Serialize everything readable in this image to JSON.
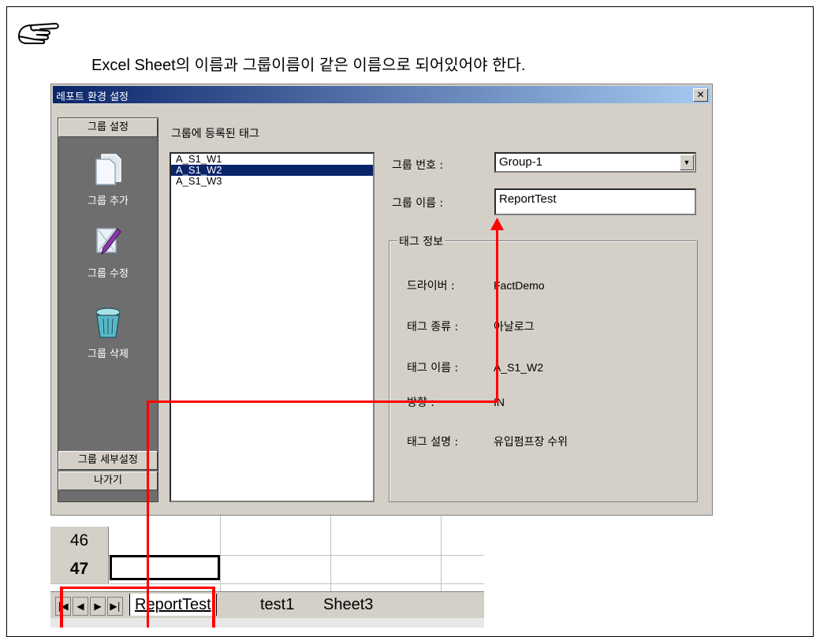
{
  "note": "Excel Sheet의 이름과 그룹이름이 같은 이름으로 되어있어야 한다.",
  "dialog": {
    "title": "레포트 환경 설정",
    "close_label": "✕",
    "sidebar": {
      "top_button": "그룹 설정",
      "items": [
        {
          "label": "그룹 추가",
          "icon": "pages-icon"
        },
        {
          "label": "그룹 수정",
          "icon": "edit-pencil-icon"
        },
        {
          "label": "그룹 삭제",
          "icon": "trash-can-icon"
        }
      ],
      "detail_button": "그룹 세부설정",
      "exit_button": "나가기"
    },
    "tag_list_title": "그룹에 등록된 태그",
    "tags": [
      "A_S1_W1",
      "A_S1_W2",
      "A_S1_W3"
    ],
    "selected_tag": "A_S1_W2",
    "group_number_label": "그룹 번호 :",
    "group_number_value": "Group-1",
    "group_name_label": "그룹 이름 :",
    "group_name_value": "ReportTest",
    "tag_info": {
      "title": "태그 정보",
      "rows": [
        {
          "key": "드라이버 :",
          "value": "FactDemo"
        },
        {
          "key": "태그 종류 :",
          "value": "아날로그"
        },
        {
          "key": "태그 이름 :",
          "value": "A_S1_W2"
        },
        {
          "key": "방향 :",
          "value": "IN"
        },
        {
          "key": "태그 설명 :",
          "value": "유입펌프장 수위"
        }
      ]
    }
  },
  "excel": {
    "rows": [
      "46",
      "47"
    ],
    "sheet_tabs": [
      "ReportTest",
      "test1",
      "Sheet3"
    ],
    "active_sheet": "ReportTest"
  },
  "colors": {
    "highlight": "#ff0000",
    "selection": "#0a246a",
    "dialog_bg": "#d4d0c8",
    "sidebar_bg": "#6e6e6e"
  }
}
